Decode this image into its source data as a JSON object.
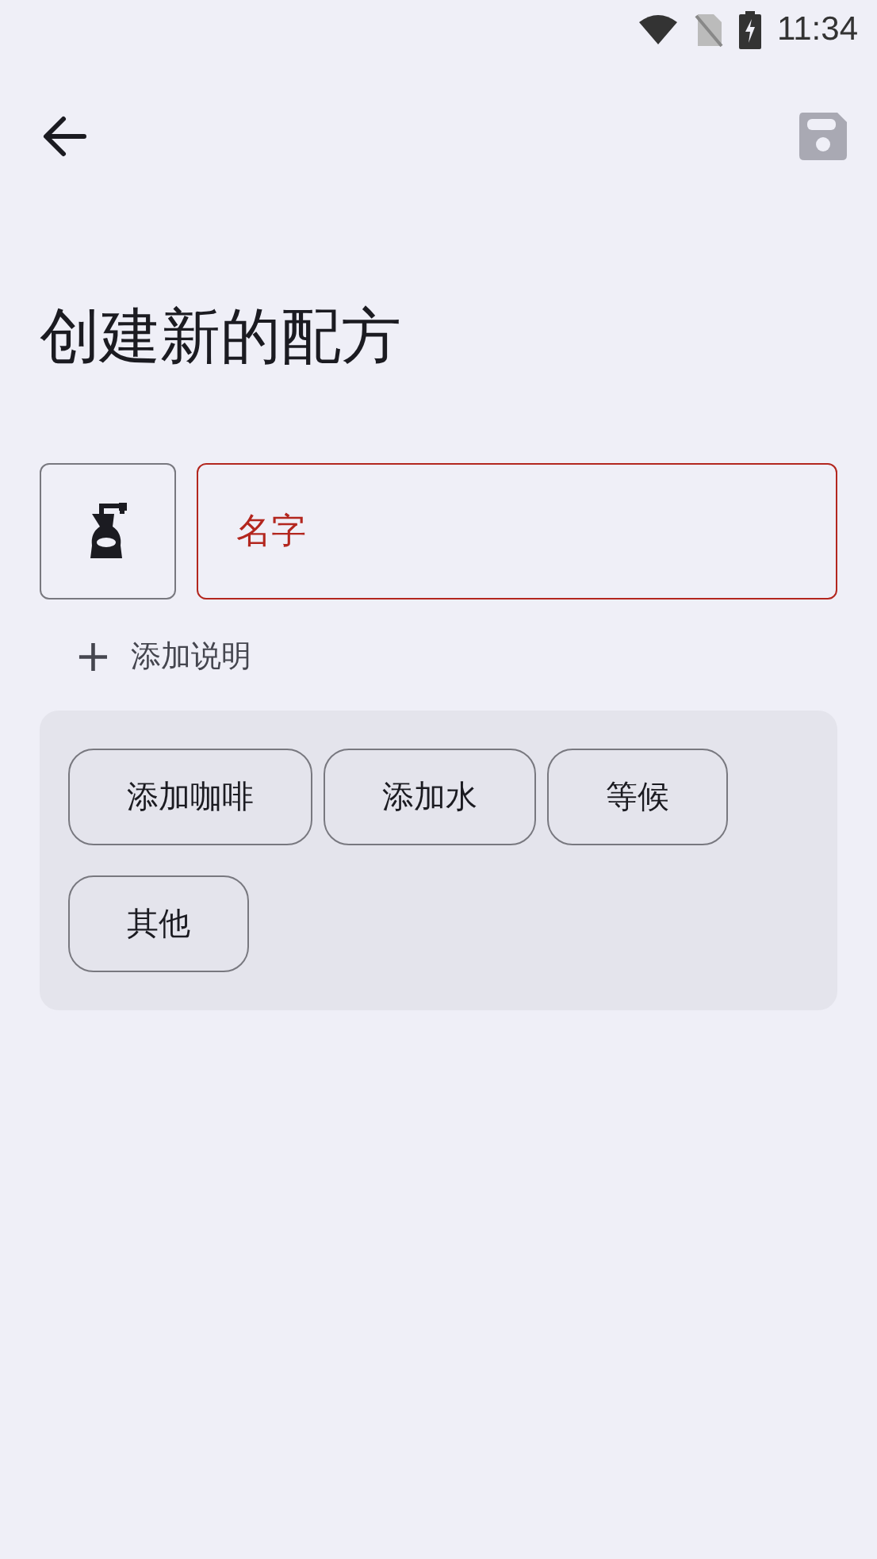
{
  "status_bar": {
    "time": "11:34"
  },
  "top_bar": {
    "save_disabled": true
  },
  "title": "创建新的配方",
  "name_field": {
    "placeholder": "名字",
    "error": true
  },
  "add_description": {
    "icon": "+",
    "label": "添加说明"
  },
  "step_buttons": [
    "添加咖啡",
    "添加水",
    "等候",
    "其他"
  ]
}
